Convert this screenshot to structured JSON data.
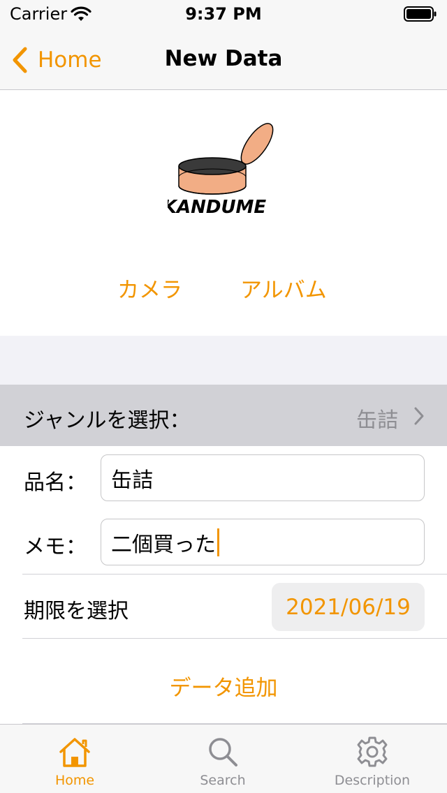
{
  "status_bar": {
    "carrier": "Carrier",
    "time": "9:37 PM"
  },
  "nav": {
    "back_label": "Home",
    "title": "New Data"
  },
  "logo": {
    "text": "KANDUME"
  },
  "photo_buttons": {
    "camera": "カメラ",
    "album": "アルバム"
  },
  "genre": {
    "label": "ジャンルを選択：",
    "value": "缶詰"
  },
  "form": {
    "name_label": "品名：",
    "name_value": "缶詰",
    "memo_label": "メモ：",
    "memo_value": "二個買った",
    "deadline_label": "期限を選択",
    "deadline_value": "2021/06/19"
  },
  "add_button": "データ追加",
  "tabs": [
    {
      "label": "Home",
      "icon": "house-icon",
      "selected": true
    },
    {
      "label": "Search",
      "icon": "magnifier-icon",
      "selected": false
    },
    {
      "label": "Description",
      "icon": "gear-icon",
      "selected": false
    }
  ],
  "colors": {
    "accent": "#f29500",
    "inactive": "#8e8e93",
    "genre_bg": "#d1d1d6",
    "group_bg": "#f2f2f7"
  }
}
